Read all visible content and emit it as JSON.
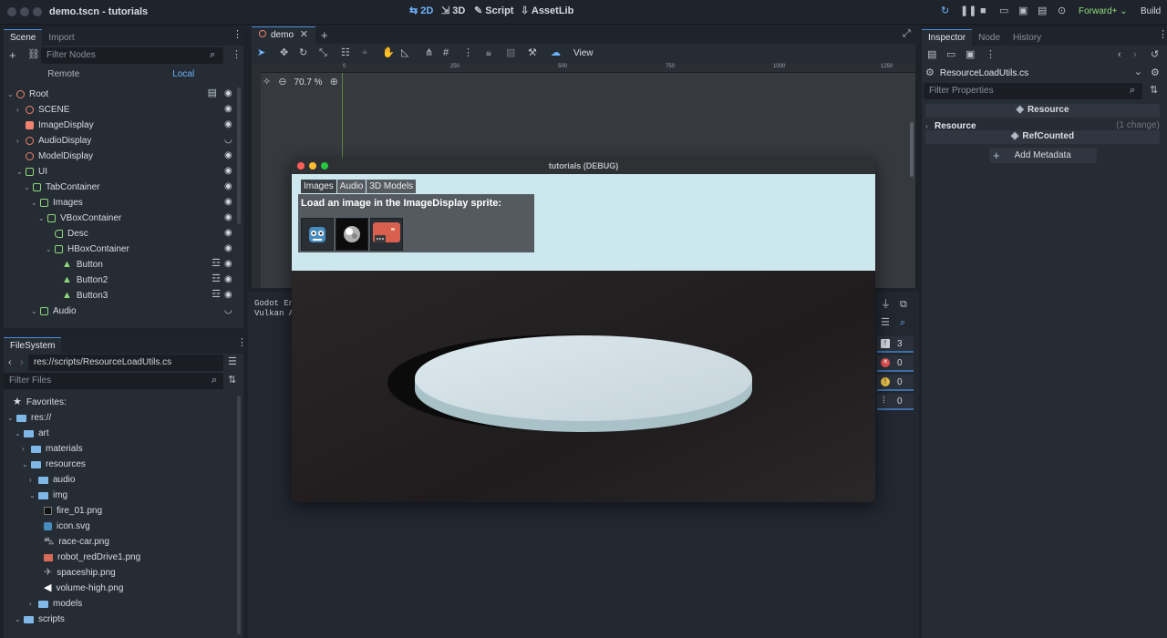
{
  "window": {
    "title": "demo.tscn - tutorials"
  },
  "workspaces": [
    {
      "label": "2D",
      "icon": "2d-icon",
      "active": true
    },
    {
      "label": "3D",
      "icon": "3d-icon",
      "active": false
    },
    {
      "label": "Script",
      "icon": "script-icon",
      "active": false
    },
    {
      "label": "AssetLib",
      "icon": "assetlib-icon",
      "active": false
    }
  ],
  "renderer": "Forward+",
  "build_label": "Build",
  "scene_dock": {
    "tabs": [
      "Scene",
      "Import"
    ],
    "filter_placeholder": "Filter Nodes",
    "remote_label": "Remote",
    "local_label": "Local",
    "nodes": [
      {
        "label": "Root",
        "icon": "node2d-icon"
      },
      {
        "label": "SCENE",
        "icon": "node2d-icon"
      },
      {
        "label": "ImageDisplay",
        "icon": "sprite-icon"
      },
      {
        "label": "AudioDisplay",
        "icon": "audio-icon"
      },
      {
        "label": "ModelDisplay",
        "icon": "node2d-icon"
      },
      {
        "label": "UI",
        "icon": "control-icon"
      },
      {
        "label": "TabContainer",
        "icon": "tabcontainer-icon"
      },
      {
        "label": "Images",
        "icon": "control-icon"
      },
      {
        "label": "VBoxContainer",
        "icon": "vbox-icon"
      },
      {
        "label": "Desc",
        "icon": "label-icon"
      },
      {
        "label": "HBoxContainer",
        "icon": "hbox-icon"
      },
      {
        "label": "Button",
        "icon": "button-icon"
      },
      {
        "label": "Button2",
        "icon": "button-icon"
      },
      {
        "label": "Button3",
        "icon": "button-icon"
      },
      {
        "label": "Audio",
        "icon": "control-icon"
      }
    ]
  },
  "filesystem": {
    "tab": "FileSystem",
    "path": "res://scripts/ResourceLoadUtils.cs",
    "filter_placeholder": "Filter Files",
    "items": [
      {
        "label": "Favorites:",
        "icon": "star-icon"
      },
      {
        "label": "res://",
        "icon": "folder-icon"
      },
      {
        "label": "art",
        "icon": "folder-icon"
      },
      {
        "label": "materials",
        "icon": "folder-icon"
      },
      {
        "label": "resources",
        "icon": "folder-icon"
      },
      {
        "label": "audio",
        "icon": "folder-icon"
      },
      {
        "label": "img",
        "icon": "folder-icon"
      },
      {
        "label": "fire_01.png",
        "icon": "image-icon"
      },
      {
        "label": "icon.svg",
        "icon": "image-icon"
      },
      {
        "label": "race-car.png",
        "icon": "image-icon"
      },
      {
        "label": "robot_redDrive1.png",
        "icon": "image-icon"
      },
      {
        "label": "spaceship.png",
        "icon": "image-icon"
      },
      {
        "label": "volume-high.png",
        "icon": "image-icon"
      },
      {
        "label": "models",
        "icon": "folder-icon"
      },
      {
        "label": "scripts",
        "icon": "folder-icon"
      }
    ]
  },
  "editor": {
    "scene_tab": "demo",
    "zoom": "70.7 %",
    "view_menu": "View",
    "ruler_ticks": [
      "0",
      "250",
      "500",
      "750",
      "1000",
      "1250"
    ],
    "output_lines": [
      "Godot En",
      "Vulkan A"
    ],
    "counters": [
      {
        "icon": "message-icon",
        "value": "3"
      },
      {
        "icon": "error-icon",
        "value": "0"
      },
      {
        "icon": "warning-icon",
        "value": "0"
      },
      {
        "icon": "info-icon",
        "value": "0"
      }
    ]
  },
  "game_window": {
    "title": "tutorials (DEBUG)",
    "tabs": [
      "Images",
      "Audio",
      "3D Models"
    ],
    "description": "Load an image in the ImageDisplay sprite:"
  },
  "inspector": {
    "tabs": [
      "Inspector",
      "Node",
      "History"
    ],
    "resource_name": "ResourceLoadUtils.cs",
    "filter_placeholder": "Filter Properties",
    "section_resource": "Resource",
    "property_resource": "Resource",
    "property_changes": "(1 change)",
    "section_refcounted": "RefCounted",
    "add_metadata": "Add Metadata"
  },
  "colors": {
    "accent": "#6eb3ff",
    "node_green": "#8eda7a",
    "node_red": "#f0826e"
  }
}
